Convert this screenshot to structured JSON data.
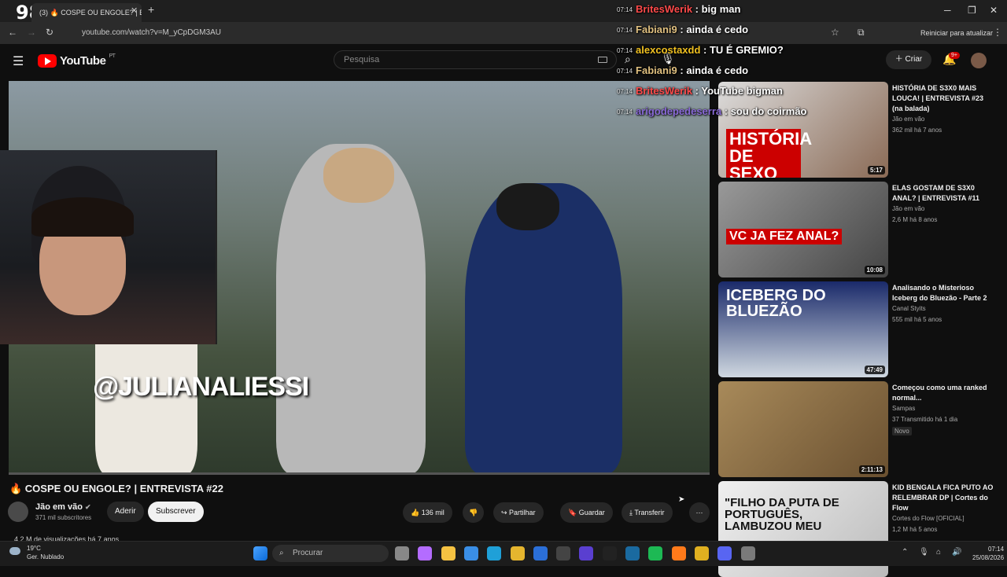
{
  "stream_overlay": {
    "viewer_count": "98"
  },
  "browser": {
    "tab_title": "(3) 🔥 COSPE OU ENGOLE? | E",
    "url": "youtube.com/watch?v=M_yCpDGM3AU",
    "restart_label": "Reiniciar para atualizar"
  },
  "youtube": {
    "logo_text": "YouTube",
    "country": "PT",
    "search_placeholder": "Pesquisa",
    "create_label": "Criar",
    "notif_count": "9+"
  },
  "video": {
    "watermark": "@JULIANALIESSI",
    "title": "🔥 COSPE OU ENGOLE? | ENTREVISTA #22",
    "channel": "Jão em vão",
    "subscribers": "371 mil subscritores",
    "join_label": "Aderir",
    "subscribe_label": "Subscrever",
    "likes": "136 mil",
    "share_label": "Partilhar",
    "save_label": "Guardar",
    "download_label": "Transferir",
    "views_line": "4,2 M de visualizações  há 7 anos"
  },
  "chat": [
    {
      "time": "07:14",
      "user": "BritesWerik",
      "color": "#ff4a4a",
      "msg": "big man"
    },
    {
      "time": "07:14",
      "user": "Fabiani9",
      "color": "#e0c080",
      "msg": "ainda é cedo"
    },
    {
      "time": "07:14",
      "user": "alexcostaxdd",
      "color": "#f0c020",
      "msg": "TU É GREMIO?"
    },
    {
      "time": "07:14",
      "user": "Fabiani9",
      "color": "#e0c080",
      "msg": "ainda é cedo"
    },
    {
      "time": "07:14",
      "user": "BritesWerik",
      "color": "#ff4a4a",
      "msg": "YouTube bigman"
    },
    {
      "time": "07:14",
      "user": "arigodepedeserra",
      "color": "#8a6ad8",
      "msg": "sou do coirmão"
    }
  ],
  "recommendations": [
    {
      "title": "HISTÓRIA DE S3X0 MAIS LOUCA! | ENTREVISTA #23 (na balada)",
      "channel": "Jão em vão",
      "meta": "362 mil  há 7 anos",
      "duration": "5:17",
      "thumb_text": "HISTÓRIA DE SEXO"
    },
    {
      "title": "ELAS GOSTAM DE S3X0 ANAL? | ENTREVISTA #11",
      "channel": "Jão em vão",
      "meta": "2,6 M  há 8 anos",
      "duration": "10:08",
      "thumb_text": "VC JA FEZ ANAL?"
    },
    {
      "title": "Analisando o Misterioso Iceberg do Bluezão - Parte 2",
      "channel": "Canal Styits",
      "meta": "555 mil  há 5 anos",
      "duration": "47:49",
      "thumb_text": "ICEBERG DO BLUEZÃO"
    },
    {
      "title": "Começou como uma ranked normal...",
      "channel": "Sampas",
      "meta": "37  Transmitido há 1 dia",
      "duration": "2:11:13",
      "badge": "Novo",
      "thumb_text": ""
    },
    {
      "title": "KID BENGALA FICA PUTO AO RELEMBRAR DP | Cortes do Flow",
      "channel": "Cortes do Flow [OFICIAL]",
      "meta": "1,2 M  há 5 anos",
      "duration": "",
      "thumb_text": "\"FILHO DA PUTA DE PORTUGUÊS, LAMBUZOU MEU"
    }
  ],
  "taskbar": {
    "temp": "19°C",
    "weather": "Ger. Nublado",
    "search_label": "Procurar",
    "time": "07:14",
    "date": "25/08/2026"
  }
}
